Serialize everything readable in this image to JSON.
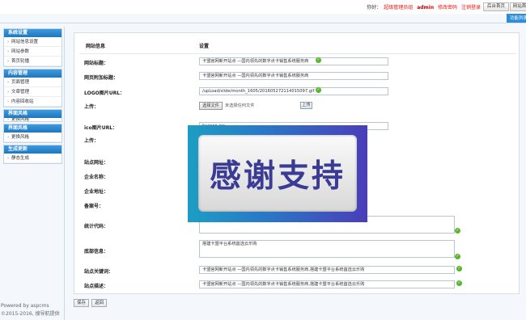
{
  "topbar": {
    "hello": "你好：",
    "role": "超级管理员组",
    "user": "admin",
    "change_pwd": "修改密码",
    "logout": "注销登录",
    "home_btn": "后台首页",
    "site_btn": "网站首",
    "func_btn": "功能列表"
  },
  "sidebar": [
    {
      "title": "系统设置",
      "items": [
        "网站信息设置",
        "网站参数",
        "首页轮播"
      ]
    },
    {
      "title": "内容管理",
      "items": [
        "页面管理",
        "文章管理",
        "内容回收站"
      ]
    },
    {
      "title": "界面风格",
      "items": [
        "更换风格"
      ]
    },
    {
      "title": "界面风格",
      "items": [
        "更换风格"
      ]
    },
    {
      "title": "生成更新",
      "items": [
        "静态生成"
      ]
    }
  ],
  "powered": [
    "Powered by aspcms",
    "©2015-2016, 搜导航提供"
  ],
  "table": {
    "col1": "网站信息",
    "col2": "设置"
  },
  "fields": {
    "site_title_label": "网站标题：",
    "site_title_value": "卡盟官网新开站点 —国内领先的数字点卡销售系统服务商",
    "site_subtitle_label": "网页附加标题：",
    "site_subtitle_value": "卡盟官网新开站点 —国内领先的数字点卡销售系统服务商",
    "logo_label": "LOGO图片URL：",
    "logo_value": "/upLoad/slide/month_1605/201605272114015097.gif",
    "upload1_label": "上传：",
    "choose_file": "选择文件",
    "no_file": "未选择任何文件",
    "upload_btn": "上传",
    "ico_label": "ico图片URL：",
    "ico_value": "favicon.ico",
    "upload2_label": "上传：",
    "site_url_label": "站点网址：",
    "company_label": "企业名称：",
    "address_label": "企业地址：",
    "icp_label": "备案号：",
    "stats_label": "统计代码：",
    "stats_value": "</head>",
    "footer_label": "底部信息：",
    "footer_value": "搭建卡盟平台系统首选云乐购",
    "keywords_label": "站点关键词：",
    "keywords_value": "卡盟官网新开站点 —国内领先的数字点卡销售系统服务商,搭建卡盟平台系统首选云乐购",
    "desc_label": "站点描述：",
    "desc_value": "卡盟官网新开站点 —国内领先的数字点卡销售系统服务商,搭建卡盟平台系统首选云乐购"
  },
  "overlay_text": "感谢支持",
  "buttons": {
    "save": "保存",
    "back": "返回"
  },
  "icons": {
    "ok": "check-circle-icon",
    "arrow": "chevron-right-icon"
  },
  "colors": {
    "sidebar_header": "#2a86cf",
    "ok_green": "#58b62a",
    "overlay_from": "#1c9ec3",
    "overlay_to": "#4b3db9"
  }
}
